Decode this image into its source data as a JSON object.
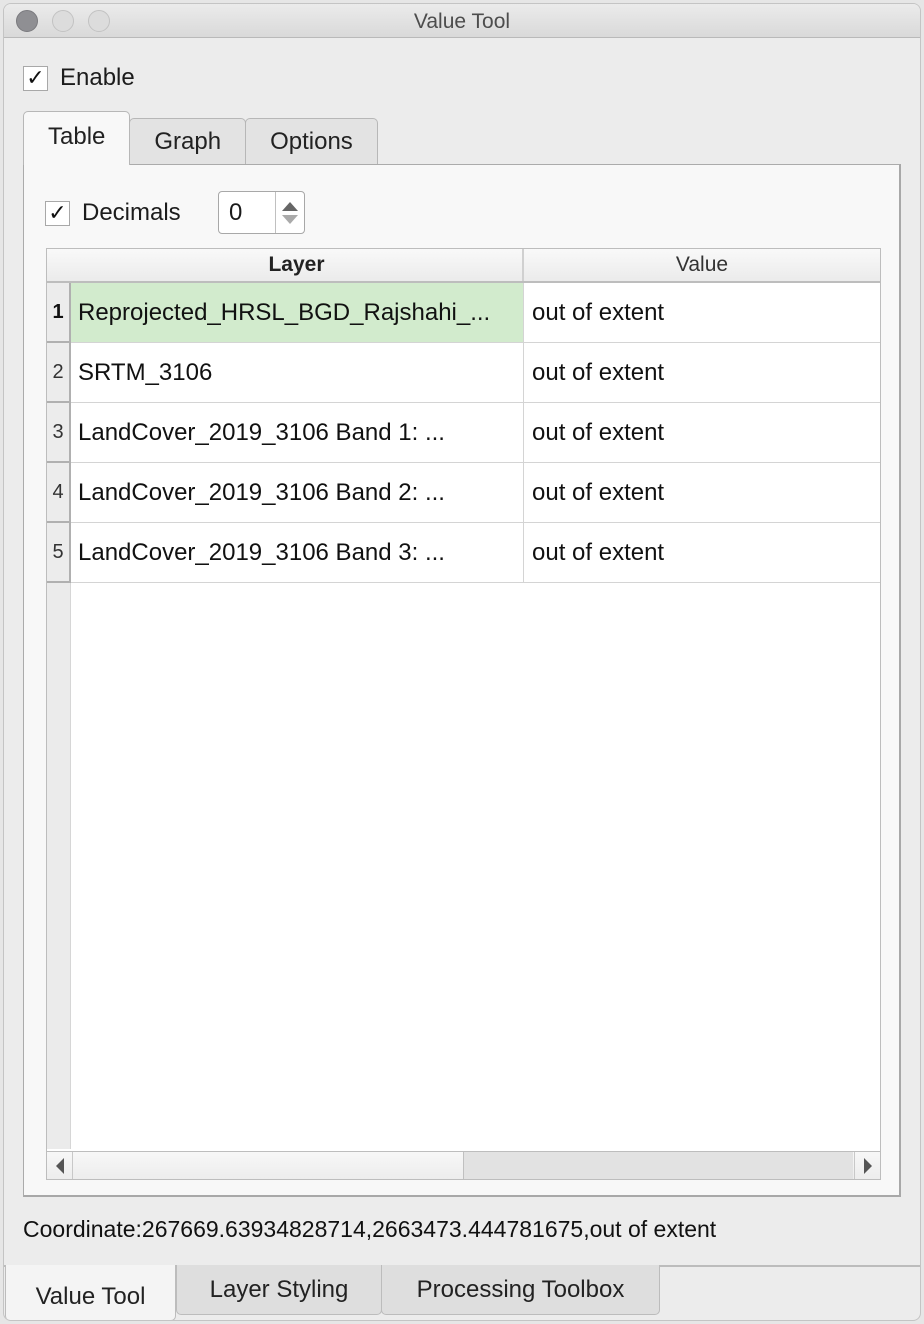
{
  "window": {
    "title": "Value Tool"
  },
  "enable": {
    "label": "Enable",
    "checked": true,
    "check_glyph": "✓"
  },
  "tabs": [
    {
      "label": "Table",
      "active": true
    },
    {
      "label": "Graph",
      "active": false
    },
    {
      "label": "Options",
      "active": false
    }
  ],
  "decimals": {
    "label": "Decimals",
    "checked": true,
    "check_glyph": "✓",
    "value": "0"
  },
  "table": {
    "columns": [
      "Layer",
      "Value"
    ],
    "rows": [
      {
        "num": "1",
        "layer": "Reprojected_HRSL_BGD_Rajshahi_...",
        "value": "out of extent",
        "selected": true
      },
      {
        "num": "2",
        "layer": "SRTM_3106",
        "value": "out of extent",
        "selected": false
      },
      {
        "num": "3",
        "layer": "LandCover_2019_3106 Band 1: ...",
        "value": "out of extent",
        "selected": false
      },
      {
        "num": "4",
        "layer": "LandCover_2019_3106 Band 2: ...",
        "value": "out of extent",
        "selected": false
      },
      {
        "num": "5",
        "layer": "LandCover_2019_3106 Band 3: ...",
        "value": "out of extent",
        "selected": false
      }
    ],
    "selected_row_color": "#d2ebcd"
  },
  "status": {
    "coordinate": "Coordinate:267669.63934828714,2663473.444781675,out of extent"
  },
  "bottom_tabs": [
    {
      "label": "Value Tool",
      "active": true
    },
    {
      "label": "Layer Styling",
      "active": false
    },
    {
      "label": "Processing Toolbox",
      "active": false
    }
  ]
}
